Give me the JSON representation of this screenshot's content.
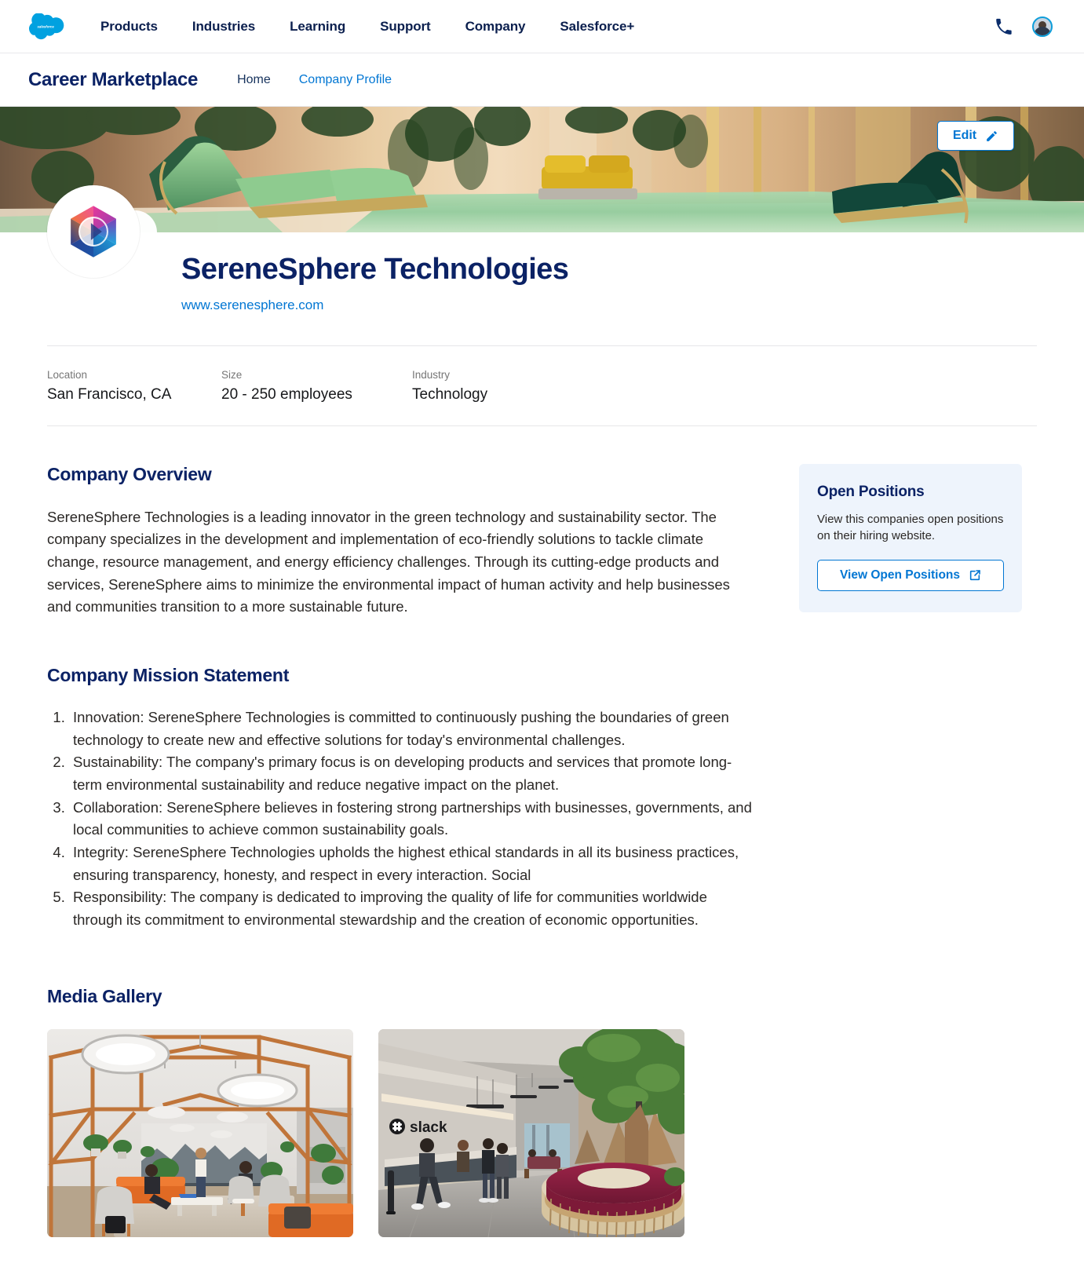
{
  "global_nav": {
    "logo_alt": "salesforce",
    "items": [
      {
        "label": "Products"
      },
      {
        "label": "Industries"
      },
      {
        "label": "Learning"
      },
      {
        "label": "Support"
      },
      {
        "label": "Company"
      },
      {
        "label": "Salesforce+"
      }
    ],
    "phone_icon": "phone-icon",
    "avatar_icon": "user-avatar"
  },
  "sub_nav": {
    "brand": "Career Marketplace",
    "links": [
      {
        "label": "Home",
        "active": false
      },
      {
        "label": "Company Profile",
        "active": true
      }
    ]
  },
  "hero": {
    "edit_label": "Edit",
    "edit_icon": "pencil-icon",
    "image_alt": "Luxury interior with green lounge chairs beside a reflecting pool"
  },
  "profile": {
    "logo_alt": "SereneSphere hexagon logo",
    "company_name": "SereneSphere Technologies",
    "website": "www.serenesphere.com",
    "meta": [
      {
        "label": "Location",
        "value": "San Francisco, CA"
      },
      {
        "label": "Size",
        "value": "20 - 250 employees"
      },
      {
        "label": "Industry",
        "value": "Technology"
      }
    ]
  },
  "overview": {
    "title": "Company Overview",
    "body": "SereneSphere Technologies is a leading innovator in the green technology and sustainability sector. The company specializes in the development and implementation of eco-friendly solutions to tackle climate change, resource management, and energy efficiency challenges. Through its cutting-edge products and services, SereneSphere aims to minimize the environmental impact of human activity and help businesses and communities transition to a more sustainable future."
  },
  "mission": {
    "title": "Company Mission Statement",
    "items": [
      "Innovation: SereneSphere Technologies is committed to continuously pushing the boundaries of green technology to create new and effective solutions for today's environmental challenges.",
      "Sustainability: The company's primary focus is on developing products and services that promote long-term environmental sustainability and reduce negative impact on the planet.",
      "Collaboration: SereneSphere believes in fostering strong partnerships with businesses, governments, and local communities to achieve common sustainability goals.",
      "Integrity: SereneSphere Technologies upholds the highest ethical standards in all its business practices, ensuring transparency, honesty, and respect in every interaction. Social",
      "Responsibility: The company is dedicated to improving the quality of life for communities worldwide through its commitment to environmental stewardship and the creation of economic opportunities."
    ]
  },
  "open_positions": {
    "title": "Open Positions",
    "description": "View this companies open positions on their hiring website.",
    "button_label": "View Open Positions",
    "button_icon": "external-link-icon"
  },
  "gallery": {
    "title": "Media Gallery",
    "items": [
      {
        "alt": "Open office lounge with timber frames, orange sofas and pendant lights"
      },
      {
        "alt": "Slack office lobby with reception desk, indoor tree and maroon circular bench"
      }
    ]
  },
  "colors": {
    "brand_navy": "#0b2265",
    "link_blue": "#0176d3",
    "card_bg": "#eef4fc",
    "text": "#2b2826",
    "muted": "#767676",
    "divider": "#e6e6e9"
  }
}
